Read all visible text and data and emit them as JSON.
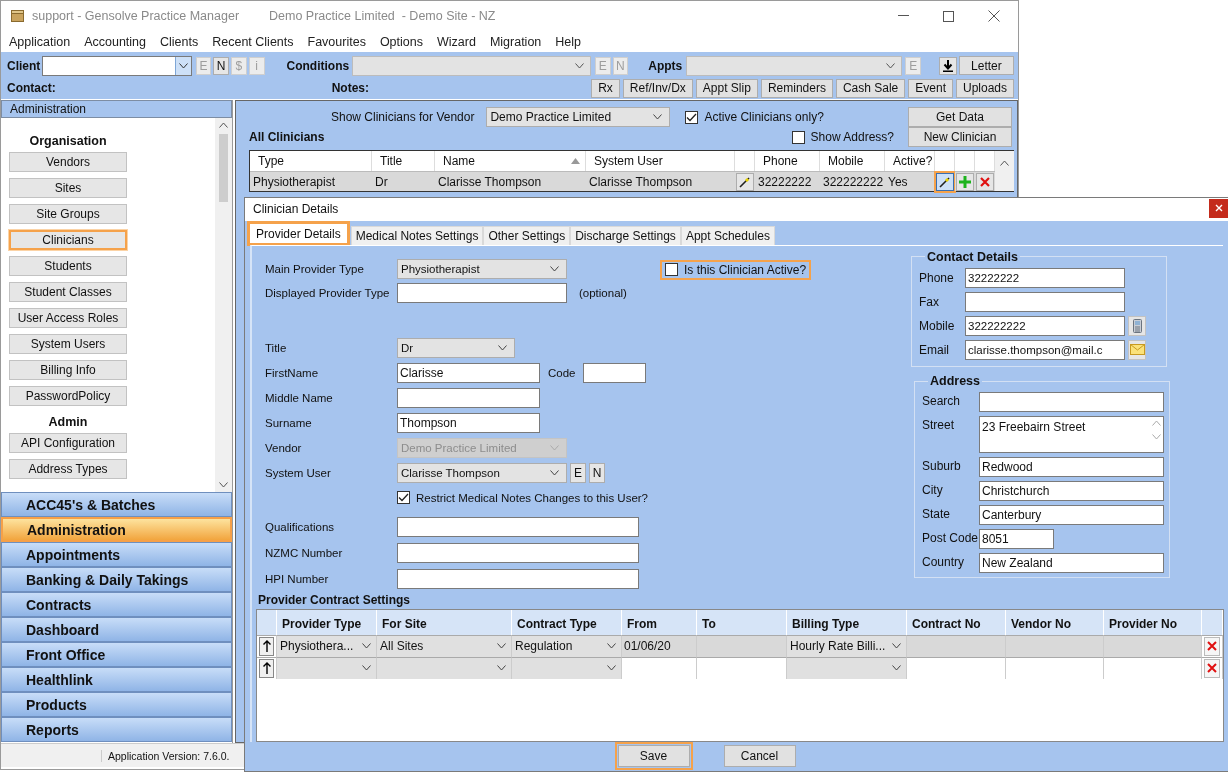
{
  "window": {
    "title": "support - Gensolve Practice Manager",
    "subtitle": "Demo Practice Limited  - Demo Site - NZ"
  },
  "menu": [
    "Application",
    "Accounting",
    "Clients",
    "Recent Clients",
    "Favourites",
    "Options",
    "Wizard",
    "Migration",
    "Help"
  ],
  "toolbar": {
    "client": {
      "label": "Client",
      "buttons": [
        {
          "label": "E",
          "disabled": true
        },
        {
          "label": "N",
          "disabled": false
        },
        {
          "label": "$",
          "disabled": true
        },
        {
          "label": "i",
          "disabled": true
        }
      ]
    },
    "conditions": {
      "label": "Conditions",
      "buttons": [
        {
          "label": "E",
          "disabled": true
        },
        {
          "label": "N",
          "disabled": true
        }
      ]
    },
    "appts": {
      "label": "Appts",
      "buttons": [
        {
          "label": "E",
          "disabled": true
        }
      ]
    },
    "letter": "Letter",
    "contact_label": "Contact:",
    "notes_label": "Notes:",
    "actions": [
      "Rx",
      "Ref/Inv/Dx",
      "Appt Slip",
      "Reminders",
      "Cash Sale",
      "Event",
      "Uploads"
    ]
  },
  "sidebar": {
    "header": "Administration",
    "groups": [
      {
        "heading": "Organisation",
        "items": [
          {
            "label": "Vendors",
            "selected": false
          },
          {
            "label": "Sites",
            "selected": false
          },
          {
            "label": "Site Groups",
            "selected": false
          },
          {
            "label": "Clinicians",
            "selected": true
          },
          {
            "label": "Students",
            "selected": false
          },
          {
            "label": "Student Classes",
            "selected": false
          },
          {
            "label": "User Access Roles",
            "selected": false
          },
          {
            "label": "System Users",
            "selected": false
          },
          {
            "label": "Billing Info",
            "selected": false
          },
          {
            "label": "PasswordPolicy",
            "selected": false
          }
        ]
      },
      {
        "heading": "Admin",
        "items": [
          {
            "label": "API Configuration",
            "selected": false
          },
          {
            "label": "Address Types",
            "selected": false
          }
        ]
      }
    ],
    "modules": [
      {
        "label": "ACC45's & Batches",
        "selected": false
      },
      {
        "label": "Administration",
        "selected": true
      },
      {
        "label": "Appointments",
        "selected": false
      },
      {
        "label": "Banking & Daily Takings",
        "selected": false
      },
      {
        "label": "Contracts",
        "selected": false
      },
      {
        "label": "Dashboard",
        "selected": false
      },
      {
        "label": "Front Office",
        "selected": false
      },
      {
        "label": "Healthlink",
        "selected": false
      },
      {
        "label": "Products",
        "selected": false
      },
      {
        "label": "Reports",
        "selected": false
      }
    ]
  },
  "status_bar": {
    "version": "Application Version: 7.6.0."
  },
  "clinicians": {
    "vendor_label": "Show Clinicians for Vendor",
    "vendor": "Demo Practice Limited",
    "active_only": {
      "label": "Active Clinicians only?",
      "checked": true
    },
    "show_address": {
      "label": "Show Address?",
      "checked": false
    },
    "buttons": [
      "Get Data",
      "New Clinician"
    ],
    "title": "All Clinicians",
    "columns": [
      {
        "label": "Type",
        "sorted": false
      },
      {
        "label": "Title",
        "sorted": false
      },
      {
        "label": "Name",
        "sorted": true
      },
      {
        "label": "System User",
        "sorted": false
      },
      {
        "label": "Phone",
        "sorted": false
      },
      {
        "label": "Mobile",
        "sorted": false
      },
      {
        "label": "Active?",
        "sorted": false
      }
    ],
    "rows": [
      {
        "cells": [
          "Physiotherapist",
          "Dr",
          "Clarisse Thompson",
          "Clarisse Thompson",
          "32222222",
          "322222222",
          "Yes"
        ],
        "edit_highlighted": true
      }
    ]
  },
  "dialog": {
    "title": "Clinician Details",
    "tabs": [
      {
        "label": "Provider Details",
        "selected": true
      },
      {
        "label": "Medical Notes Settings",
        "selected": false
      },
      {
        "label": "Other Settings",
        "selected": false
      },
      {
        "label": "Discharge Settings",
        "selected": false
      },
      {
        "label": "Appt Schedules",
        "selected": false
      }
    ],
    "form": {
      "groups": [
        [
          {
            "kind": "dropdown",
            "label": "Main Provider Type",
            "value": "Physiotherapist",
            "disabled": false
          },
          {
            "kind": "textbox-mid",
            "label": "Displayed Provider Type",
            "note": "(optional)",
            "disabled": false
          }
        ],
        [
          {
            "kind": "dropdown-small",
            "label": "Title",
            "value": "Dr",
            "disabled": false
          },
          {
            "kind": "textbox",
            "label": "FirstName",
            "value": "Clarisse",
            "side_label": "Code",
            "disabled": false
          },
          {
            "kind": "textbox",
            "label": "Middle Name",
            "disabled": false
          },
          {
            "kind": "textbox",
            "label": "Surname",
            "value": "Thompson",
            "disabled": false
          },
          {
            "kind": "dropdown",
            "label": "Vendor",
            "value": "Demo Practice Limited",
            "disabled": true
          },
          {
            "kind": "dropdown",
            "label": "System User",
            "value": "Clarisse Thompson",
            "buttons": [
              "E",
              "N"
            ],
            "disabled": false
          },
          {
            "kind": "checkbox",
            "label": "Restrict Medical Notes Changes to this User?",
            "checked": true,
            "disabled": false
          }
        ],
        [
          {
            "kind": "textbox-long",
            "label": "Qualifications",
            "disabled": false
          },
          {
            "kind": "textbox-long",
            "label": "NZMC Number",
            "disabled": false
          },
          {
            "kind": "textbox-long",
            "label": "HPI Number",
            "disabled": false
          }
        ]
      ],
      "active": {
        "label": "Is this Clinician Active?",
        "checked": false,
        "highlighted": true
      }
    },
    "contact": {
      "title": "Contact Details",
      "fields": [
        {
          "kind": "plain",
          "label": "Phone",
          "value": "32222222"
        },
        {
          "kind": "plain",
          "label": "Fax"
        },
        {
          "kind": "mobile",
          "label": "Mobile",
          "value": "322222222"
        },
        {
          "kind": "email",
          "label": "Email",
          "value": "clarisse.thompson@mail.c"
        }
      ]
    },
    "address": {
      "title": "Address",
      "fields": [
        {
          "kind": "text",
          "label": "Search"
        },
        {
          "kind": "multiline",
          "label": "Street",
          "value": "23 Freebairn Street"
        },
        {
          "kind": "text",
          "label": "Suburb",
          "value": "Redwood"
        },
        {
          "kind": "text",
          "label": "City",
          "value": "Christchurch"
        },
        {
          "kind": "text",
          "label": "State",
          "value": "Canterbury"
        },
        {
          "kind": "short",
          "label": "Post Code",
          "value": "8051"
        },
        {
          "kind": "text",
          "label": "Country",
          "value": "New Zealand"
        }
      ]
    },
    "contracts": {
      "title": "Provider Contract Settings",
      "columns": [
        {
          "label": "Provider Type",
          "kind": "dropdown"
        },
        {
          "label": "For Site",
          "kind": "dropdown"
        },
        {
          "label": "Contract Type",
          "kind": "dropdown"
        },
        {
          "label": "From",
          "kind": "text"
        },
        {
          "label": "To",
          "kind": "text"
        },
        {
          "label": "Billing Type",
          "kind": "dropdown"
        },
        {
          "label": "Contract No",
          "kind": "text"
        },
        {
          "label": "Vendor No",
          "kind": "text"
        },
        {
          "label": "Provider No",
          "kind": "text"
        }
      ],
      "rows": [
        {
          "locked": true,
          "cells": [
            "Physiothera...",
            "All Sites",
            "Regulation",
            "01/06/20",
            null,
            "Hourly Rate Billi...",
            null,
            null,
            null
          ]
        },
        {
          "locked": false,
          "cells": [
            null,
            null,
            null,
            null,
            null,
            null,
            null,
            null,
            null
          ]
        }
      ]
    },
    "buttons": [
      {
        "label": "Save",
        "highlighted": true
      },
      {
        "label": "Cancel",
        "highlighted": false
      }
    ]
  }
}
